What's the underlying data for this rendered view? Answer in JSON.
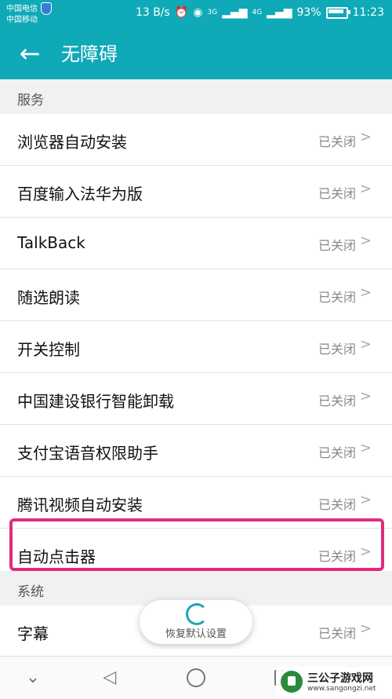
{
  "status_bar": {
    "carrier_1": "中国电信",
    "carrier_2": "中国移动",
    "speed": "13 B/s",
    "signal_1": "3G",
    "signal_2": "4G",
    "battery": "93%",
    "battery_level": 0.93,
    "time": "11:23"
  },
  "app_bar": {
    "title": "无障碍",
    "back_icon": "arrow-left-icon"
  },
  "sections": {
    "services": "服务",
    "system": "系统"
  },
  "service_items": [
    {
      "label": "浏览器自动安装",
      "status": "已关闭"
    },
    {
      "label": "百度输入法华为版",
      "status": "已关闭"
    },
    {
      "label": "TalkBack",
      "status": "已关闭"
    },
    {
      "label": "随选朗读",
      "status": "已关闭"
    },
    {
      "label": "开关控制",
      "status": "已关闭"
    },
    {
      "label": "中国建设银行智能卸载",
      "status": "已关闭"
    },
    {
      "label": "支付宝语音权限助手",
      "status": "已关闭"
    },
    {
      "label": "腾讯视频自动安装",
      "status": "已关闭"
    },
    {
      "label": "自动点击器",
      "status": "已关闭"
    }
  ],
  "system_items": [
    {
      "label": "字幕",
      "status": "已关闭"
    }
  ],
  "toast": {
    "text": "恢复默认设置"
  },
  "highlight_color": "#e02b7e",
  "accent_color": "#0fa9b8",
  "watermark": {
    "name": "三公子游戏网",
    "url": "www.sangongzi.net"
  }
}
